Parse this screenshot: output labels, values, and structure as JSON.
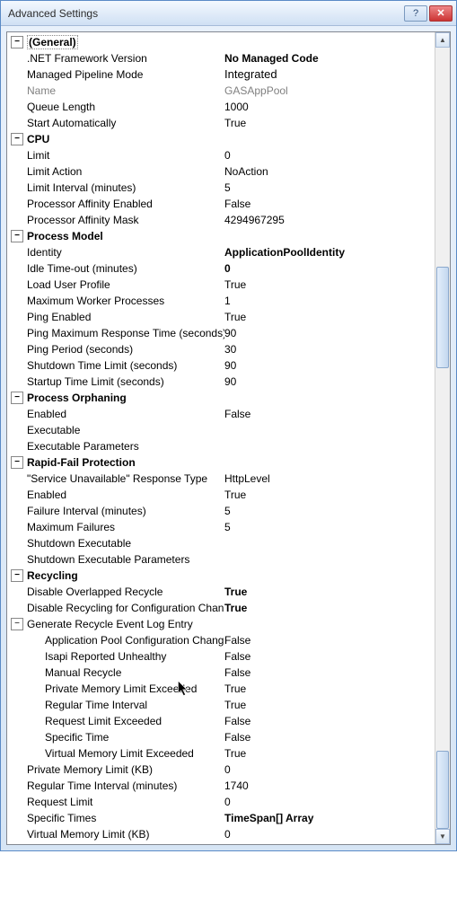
{
  "window": {
    "title": "Advanced Settings"
  },
  "sections": {
    "general": {
      "cat_label": "(General)",
      "net_framework_version": {
        "label": ".NET Framework Version",
        "value": "No Managed Code"
      },
      "managed_pipeline_mode": {
        "label": "Managed Pipeline Mode",
        "value": "Integrated"
      },
      "name": {
        "label": "Name",
        "value": "GASAppPool"
      },
      "queue_length": {
        "label": "Queue Length",
        "value": "1000"
      },
      "start_automatically": {
        "label": "Start Automatically",
        "value": "True"
      }
    },
    "cpu": {
      "cat_label": "CPU",
      "limit": {
        "label": "Limit",
        "value": "0"
      },
      "limit_action": {
        "label": "Limit Action",
        "value": "NoAction"
      },
      "limit_interval": {
        "label": "Limit Interval (minutes)",
        "value": "5"
      },
      "processor_affinity_enabled": {
        "label": "Processor Affinity Enabled",
        "value": "False"
      },
      "processor_affinity_mask": {
        "label": "Processor Affinity Mask",
        "value": "4294967295"
      }
    },
    "process_model": {
      "cat_label": "Process Model",
      "identity": {
        "label": "Identity",
        "value": "ApplicationPoolIdentity"
      },
      "idle_timeout": {
        "label": "Idle Time-out (minutes)",
        "value": "0"
      },
      "load_user_profile": {
        "label": "Load User Profile",
        "value": "True"
      },
      "max_worker_processes": {
        "label": "Maximum Worker Processes",
        "value": "1"
      },
      "ping_enabled": {
        "label": "Ping Enabled",
        "value": "True"
      },
      "ping_max_response": {
        "label": "Ping Maximum Response Time (seconds)",
        "value": "90"
      },
      "ping_period": {
        "label": "Ping Period (seconds)",
        "value": "30"
      },
      "shutdown_time_limit": {
        "label": "Shutdown Time Limit (seconds)",
        "value": "90"
      },
      "startup_time_limit": {
        "label": "Startup Time Limit (seconds)",
        "value": "90"
      }
    },
    "process_orphaning": {
      "cat_label": "Process Orphaning",
      "enabled": {
        "label": "Enabled",
        "value": "False"
      },
      "executable": {
        "label": "Executable",
        "value": ""
      },
      "executable_params": {
        "label": "Executable Parameters",
        "value": ""
      }
    },
    "rapid_fail": {
      "cat_label": "Rapid-Fail Protection",
      "service_unavailable_type": {
        "label": "\"Service Unavailable\" Response Type",
        "value": "HttpLevel"
      },
      "enabled": {
        "label": "Enabled",
        "value": "True"
      },
      "failure_interval": {
        "label": "Failure Interval (minutes)",
        "value": "5"
      },
      "maximum_failures": {
        "label": "Maximum Failures",
        "value": "5"
      },
      "shutdown_executable": {
        "label": "Shutdown Executable",
        "value": ""
      },
      "shutdown_executable_params": {
        "label": "Shutdown Executable Parameters",
        "value": ""
      }
    },
    "recycling": {
      "cat_label": "Recycling",
      "disable_overlapped": {
        "label": "Disable Overlapped Recycle",
        "value": "True"
      },
      "disable_for_config": {
        "label": "Disable Recycling for Configuration Changes",
        "value": "True"
      },
      "generate_log": {
        "cat_label": "Generate Recycle Event Log Entry",
        "app_pool_config_change": {
          "label": "Application Pool Configuration Change",
          "value": "False"
        },
        "isapi_unhealthy": {
          "label": "Isapi Reported Unhealthy",
          "value": "False"
        },
        "manual_recycle": {
          "label": "Manual Recycle",
          "value": "False"
        },
        "private_memory_exceeded": {
          "label": "Private Memory Limit Exceeded",
          "value": "True"
        },
        "regular_time_interval": {
          "label": "Regular Time Interval",
          "value": "True"
        },
        "request_limit_exceeded": {
          "label": "Request Limit Exceeded",
          "value": "False"
        },
        "specific_time": {
          "label": "Specific Time",
          "value": "False"
        },
        "virtual_memory_exceeded": {
          "label": "Virtual Memory Limit Exceeded",
          "value": "True"
        }
      },
      "private_memory_kb": {
        "label": "Private Memory Limit (KB)",
        "value": "0"
      },
      "regular_time_interval_min": {
        "label": "Regular Time Interval (minutes)",
        "value": "1740"
      },
      "request_limit": {
        "label": "Request Limit",
        "value": "0"
      },
      "specific_times": {
        "label": "Specific Times",
        "value": "TimeSpan[] Array"
      },
      "virtual_memory_kb": {
        "label": "Virtual Memory Limit (KB)",
        "value": "0"
      }
    }
  }
}
